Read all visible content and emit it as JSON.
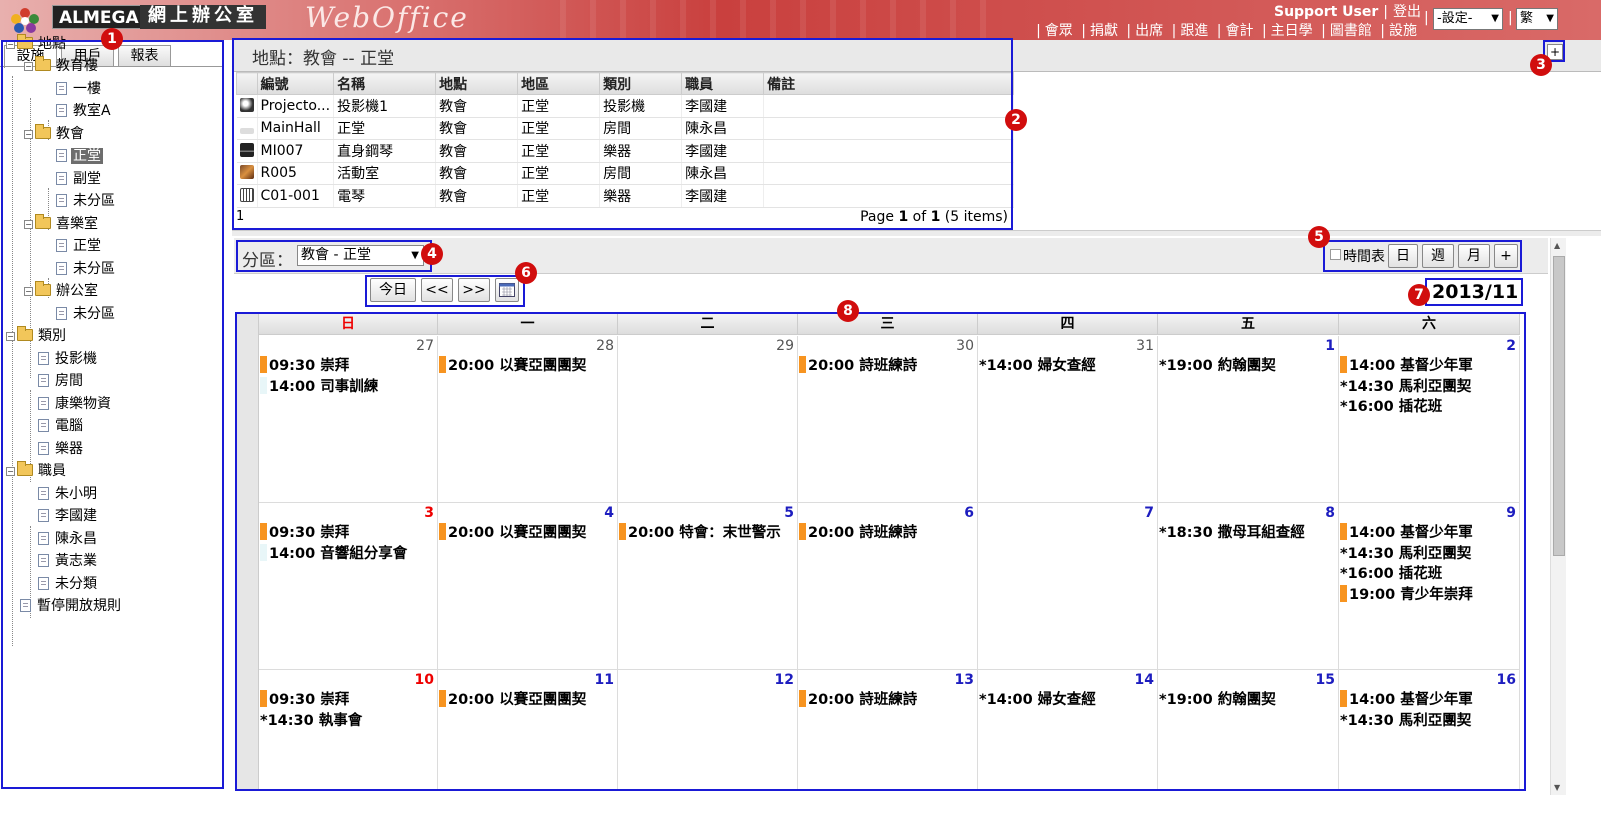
{
  "header": {
    "brand": "ALMEGA",
    "brand_cn": "網上辦公室",
    "product": "WebOffice",
    "user": "Support User",
    "logout": "登出",
    "nav": [
      "會眾",
      "捐獻",
      "出席",
      "跟進",
      "會計",
      "主日學",
      "圖書館",
      "設施"
    ],
    "settings_select": "-設定-",
    "lang_select": "繁"
  },
  "left_tabs": [
    "設施",
    "用戶",
    "報表"
  ],
  "tree": {
    "locations": "地點",
    "edu_building": "教育樓",
    "floor1": "一樓",
    "classroom_a": "教室A",
    "church": "教會",
    "main_hall": "正堂",
    "side_hall": "副堂",
    "unassigned": "未分區",
    "joy_room": "喜樂室",
    "joy_main": "正堂",
    "office": "辦公室",
    "categories": "類別",
    "projector": "投影機",
    "room": "房間",
    "recreation": "康樂物資",
    "computer": "電腦",
    "instrument": "樂器",
    "staff": "職員",
    "staff_1": "朱小明",
    "staff_2": "李國建",
    "staff_3": "陳永昌",
    "staff_4": "黃志業",
    "uncategorized": "未分類",
    "suspend_rules": "暫停開放規則"
  },
  "grid": {
    "title": "地點：教會 -- 正堂",
    "columns": [
      "編號",
      "名稱",
      "地點",
      "地區",
      "類別",
      "職員",
      "備註"
    ],
    "rows": [
      [
        "Projecto...",
        "投影機1",
        "教會",
        "正堂",
        "投影機",
        "李國建",
        ""
      ],
      [
        "MainHall",
        "正堂",
        "教會",
        "正堂",
        "房間",
        "陳永昌",
        ""
      ],
      [
        "MI007",
        "直身鋼琴",
        "教會",
        "正堂",
        "樂器",
        "李國建",
        ""
      ],
      [
        "R005",
        "活動室",
        "教會",
        "正堂",
        "房間",
        "陳永昌",
        ""
      ],
      [
        "C01-001",
        "電琴",
        "教會",
        "正堂",
        "樂器",
        "李國建",
        ""
      ]
    ],
    "footer_left": "1",
    "pager_prefix": "Page ",
    "pager_page": "1",
    "pager_of": " of ",
    "pager_total": "1",
    "pager_suffix": " (5 items)",
    "expand_label": "+"
  },
  "calendar": {
    "zone_label": "分區：",
    "zone_value": "教會 - 正堂",
    "timetable_label": "時間表",
    "view_day": "日",
    "view_week": "週",
    "view_month": "月",
    "view_plus": "+",
    "today": "今日",
    "prev": "<<",
    "next": ">>",
    "month_label": "2013/11",
    "weekdays": [
      "日",
      "一",
      "二",
      "三",
      "四",
      "五",
      "六"
    ],
    "weeks": [
      {
        "days": [
          {
            "num": "27",
            "out": true,
            "events": [
              {
                "t": "09:30 崇拜",
                "m": "o"
              },
              {
                "t": "14:00 司事訓練",
                "m": "b"
              }
            ]
          },
          {
            "num": "28",
            "out": true,
            "events": [
              {
                "t": "20:00 以賽亞團團契",
                "m": "o"
              }
            ]
          },
          {
            "num": "29",
            "out": true,
            "events": []
          },
          {
            "num": "30",
            "out": true,
            "events": [
              {
                "t": "20:00 詩班練詩",
                "m": "o"
              }
            ]
          },
          {
            "num": "31",
            "out": true,
            "events": [
              {
                "t": "*14:00 婦女查經",
                "m": ""
              }
            ]
          },
          {
            "num": "1",
            "out": false,
            "events": [
              {
                "t": "*19:00 約翰團契",
                "m": ""
              }
            ]
          },
          {
            "num": "2",
            "out": false,
            "events": [
              {
                "t": "14:00 基督少年軍",
                "m": "o"
              },
              {
                "t": "*14:30 馬利亞團契",
                "m": ""
              },
              {
                "t": "*16:00 插花班",
                "m": ""
              }
            ]
          }
        ]
      },
      {
        "days": [
          {
            "num": "3",
            "out": false,
            "events": [
              {
                "t": "09:30 崇拜",
                "m": "o"
              },
              {
                "t": "14:00 音響組分享會",
                "m": "b"
              }
            ]
          },
          {
            "num": "4",
            "out": false,
            "events": [
              {
                "t": "20:00 以賽亞團團契",
                "m": "o"
              }
            ]
          },
          {
            "num": "5",
            "out": false,
            "events": [
              {
                "t": "20:00 特會：末世警示",
                "m": "o"
              }
            ]
          },
          {
            "num": "6",
            "out": false,
            "events": [
              {
                "t": "20:00 詩班練詩",
                "m": "o"
              }
            ]
          },
          {
            "num": "7",
            "out": false,
            "events": []
          },
          {
            "num": "8",
            "out": false,
            "events": [
              {
                "t": "*18:30 撒母耳組查經",
                "m": ""
              }
            ]
          },
          {
            "num": "9",
            "out": false,
            "events": [
              {
                "t": "14:00 基督少年軍",
                "m": "o"
              },
              {
                "t": "*14:30 馬利亞團契",
                "m": ""
              },
              {
                "t": "*16:00 插花班",
                "m": ""
              },
              {
                "t": "19:00 青少年崇拜",
                "m": "o"
              }
            ]
          }
        ]
      },
      {
        "days": [
          {
            "num": "10",
            "out": false,
            "events": [
              {
                "t": "09:30 崇拜",
                "m": "o"
              },
              {
                "t": "*14:30 執事會",
                "m": ""
              }
            ]
          },
          {
            "num": "11",
            "out": false,
            "events": [
              {
                "t": "20:00 以賽亞團團契",
                "m": "o"
              }
            ]
          },
          {
            "num": "12",
            "out": false,
            "events": []
          },
          {
            "num": "13",
            "out": false,
            "events": [
              {
                "t": "20:00 詩班練詩",
                "m": "o"
              }
            ]
          },
          {
            "num": "14",
            "out": false,
            "events": [
              {
                "t": "*14:00 婦女查經",
                "m": ""
              }
            ]
          },
          {
            "num": "15",
            "out": false,
            "events": [
              {
                "t": "*19:00 約翰團契",
                "m": ""
              }
            ]
          },
          {
            "num": "16",
            "out": false,
            "events": [
              {
                "t": "14:00 基督少年軍",
                "m": "o"
              },
              {
                "t": "*14:30 馬利亞團契",
                "m": ""
              }
            ]
          }
        ]
      }
    ]
  },
  "annotations": [
    "1",
    "2",
    "3",
    "4",
    "5",
    "6",
    "7",
    "8"
  ],
  "colors": {
    "annotation_box": "#1a1ad6",
    "badge": "#d10d0d",
    "event_marker": "#f79420",
    "sunday": "#e00000",
    "date_blue": "#1d1dbf"
  }
}
